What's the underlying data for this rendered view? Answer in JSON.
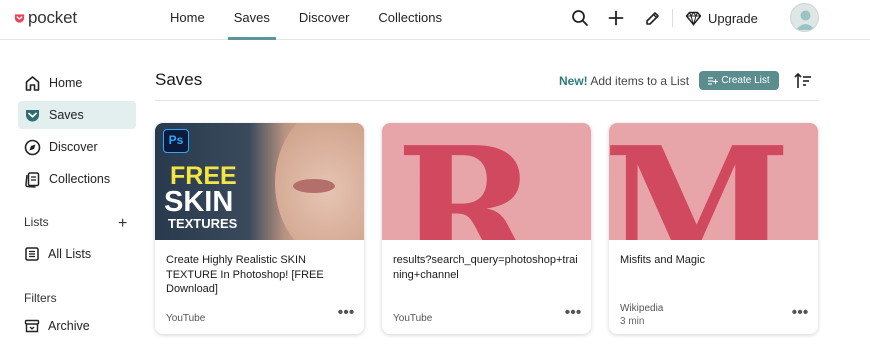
{
  "app": {
    "logo_text": "pocket"
  },
  "topnav": {
    "items": [
      {
        "label": "Home"
      },
      {
        "label": "Saves"
      },
      {
        "label": "Discover"
      },
      {
        "label": "Collections"
      }
    ],
    "active": "Saves",
    "upgrade_label": "Upgrade",
    "icons": [
      "search-icon",
      "add-icon",
      "highlighter-icon",
      "diamond-icon",
      "avatar"
    ]
  },
  "sidebar": {
    "items": [
      {
        "label": "Home",
        "icon": "home-icon"
      },
      {
        "label": "Saves",
        "icon": "pocket-icon"
      },
      {
        "label": "Discover",
        "icon": "compass-icon"
      },
      {
        "label": "Collections",
        "icon": "collections-icon"
      }
    ],
    "lists_heading": "Lists",
    "all_lists_label": "All Lists",
    "filters_heading": "Filters",
    "archive_label": "Archive"
  },
  "main": {
    "title": "Saves",
    "new_badge": "New!",
    "new_text": "Add items to a List",
    "create_list_label": "Create List"
  },
  "cards": [
    {
      "title": "Create Highly Realistic SKIN TEXTURE In Photoshop! [FREE Download]",
      "source": "YouTube",
      "thumb_text": {
        "badge": "Ps",
        "line1": "FREE",
        "line2": "SKIN",
        "line3": "TEXTURES"
      }
    },
    {
      "title": "results?search_query=photoshop+training+channel",
      "source": "YouTube",
      "thumb_letter": "R"
    },
    {
      "title": "Misfits and Magic",
      "source": "Wikipedia",
      "time": "3 min",
      "thumb_letter": "M"
    }
  ],
  "colors": {
    "accent": "#5b9499",
    "brand_red": "#ef4056",
    "placeholder_bg": "#e7a4a9",
    "placeholder_letter": "#d0495e",
    "create_button": "#5b8d8f"
  }
}
